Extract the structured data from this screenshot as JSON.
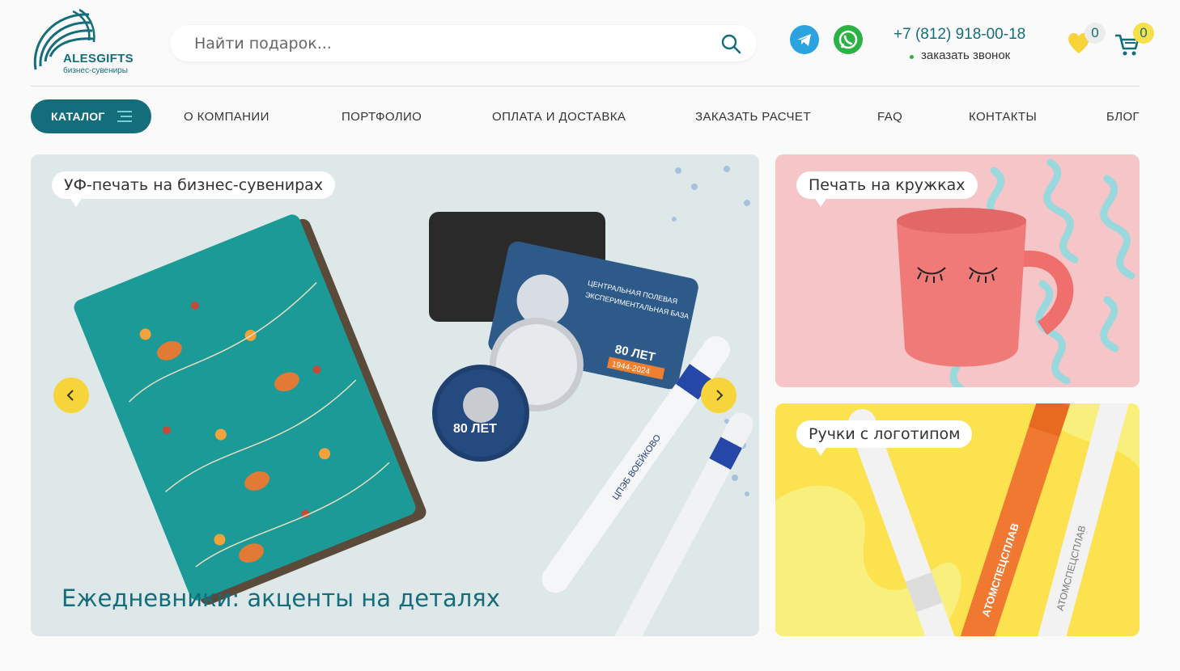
{
  "brand": {
    "name": "ALESGIFTS",
    "tagline": "бизнес-сувениры"
  },
  "search": {
    "placeholder": "Найти подарок..."
  },
  "contacts": {
    "phone": "+7 (812) 918-00-18",
    "callback_label": "заказать звонок"
  },
  "counters": {
    "favorites": "0",
    "cart": "0"
  },
  "nav": {
    "catalog_label": "КАТАЛОГ",
    "items": [
      "О КОМПАНИИ",
      "ПОРТФОЛИО",
      "ОПЛАТА И ДОСТАВКА",
      "ЗАКАЗАТЬ РАСЧЕТ",
      "FAQ",
      "КОНТАКТЫ",
      "БЛОГ"
    ]
  },
  "hero": {
    "tag": "УФ-печать на бизнес-сувенирах",
    "title": "Ежедневники: акценты на деталях",
    "badge_text": "80 ЛЕТ",
    "badge_years": "1944-2024",
    "card_text_1": "ЦЕНТРАЛЬНАЯ ПОЛЕВАЯ",
    "card_text_2": "ЭКСПЕРИМЕНТАЛЬНАЯ БАЗА",
    "pen_text": "ЦПЭБ ВОЕЙКОВО"
  },
  "promo_mugs": {
    "tag": "Печать на кружках"
  },
  "promo_pens": {
    "tag": "Ручки с логотипом",
    "pen_text_1": "АТОМСПЕЦСПЛАВ",
    "pen_text_2": "АТОМСПЕЦСПЛАВ"
  },
  "colors": {
    "accent": "#146d7a",
    "yellow": "#f7d43a",
    "telegram": "#2aa3e0",
    "whatsapp": "#2bb144"
  }
}
